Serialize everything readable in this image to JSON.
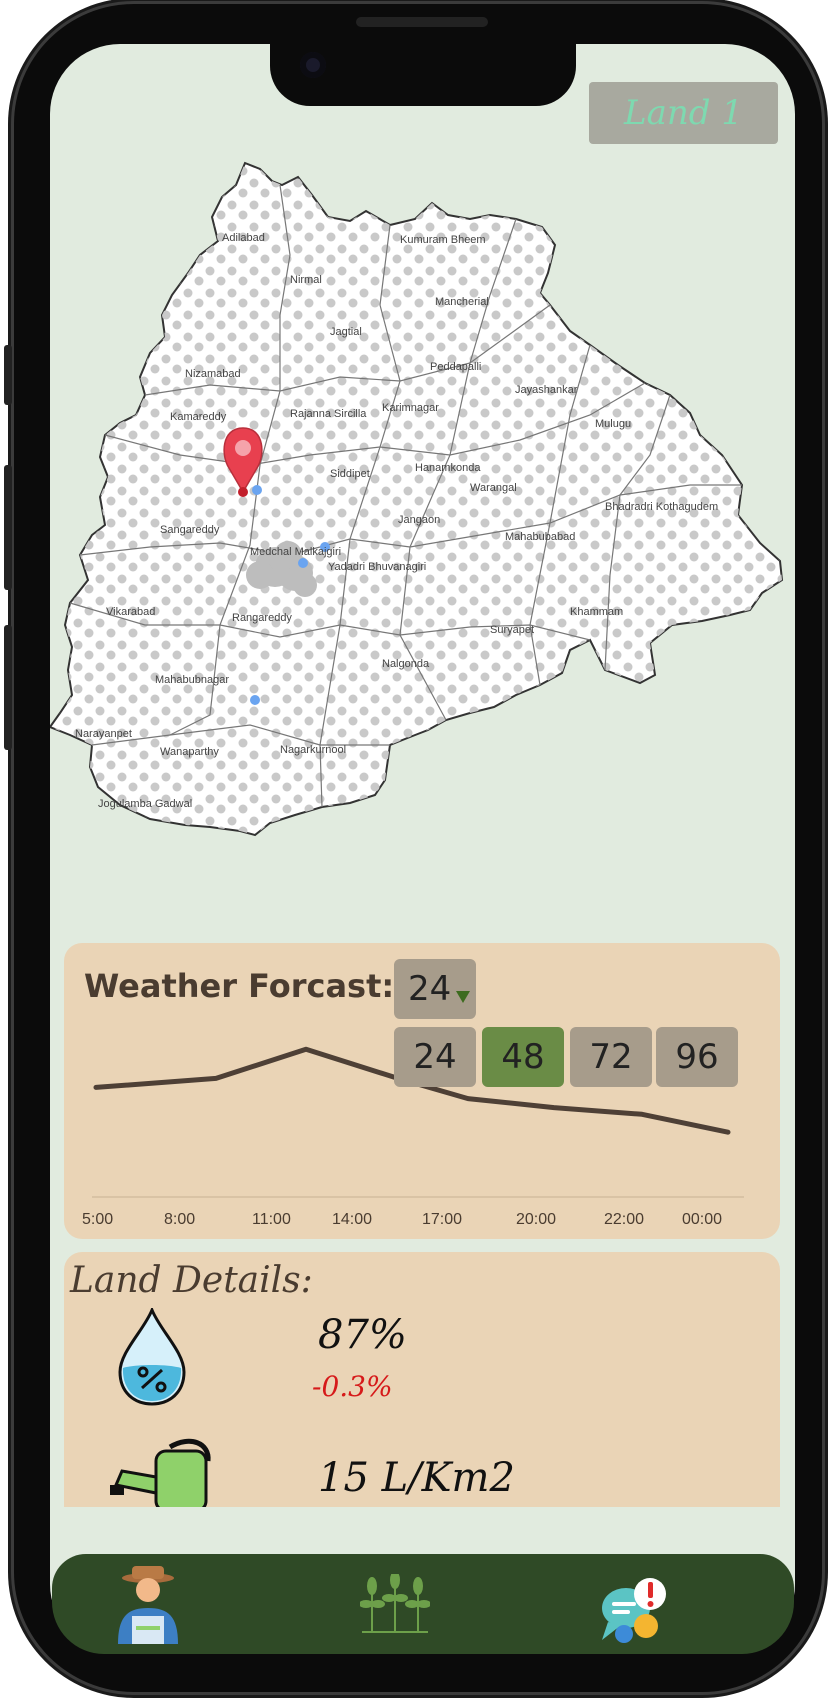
{
  "header": {
    "land_label": "Land 1"
  },
  "map": {
    "districts": [
      "Adilabad",
      "Kumuram Bheem",
      "Nirmal",
      "Mancherial",
      "Jagtial",
      "Nizamabad",
      "Peddapalli",
      "Jayashankar",
      "Kamareddy",
      "Rajanna Sircilla",
      "Karimnagar",
      "Mulugu",
      "Siddipet",
      "Hanamkonda",
      "Warangal",
      "Bhadradri Kothagudem",
      "Sangareddy",
      "Jangaon",
      "Mahabubabad",
      "Medchal Malkajgiri",
      "Yadadri Bhuvanagiri",
      "Vikarabad",
      "Rangareddy",
      "Khammam",
      "Suryapet",
      "Mahabubnagar",
      "Nalgonda",
      "Narayanpet",
      "Wanaparthy",
      "Nagarkurnool",
      "Jogulamba Gadwal"
    ],
    "pin_icon": "location-pin-icon"
  },
  "weather": {
    "title": "Weather Forcast:",
    "selected_hours": "24",
    "hour_options": [
      "24",
      "48",
      "72",
      "96"
    ],
    "active_option": "48"
  },
  "chart_data": {
    "type": "line",
    "title": "",
    "x": [
      "5:00",
      "8:00",
      "11:00",
      "14:00",
      "17:00",
      "20:00",
      "22:00",
      "00:00"
    ],
    "series": [
      {
        "values": [
          40,
          44,
          57,
          44,
          35,
          31,
          28,
          20
        ]
      }
    ],
    "ylim": [
      0,
      100
    ],
    "xlabel": "",
    "ylabel": "",
    "grid": false,
    "line_color": "#4e4036"
  },
  "land_details": {
    "title": "Land Details:",
    "moisture": {
      "icon": "water-drop-percent-icon",
      "value": "87%",
      "change": "-0.3%"
    },
    "water": {
      "icon": "watering-can-icon",
      "value": "15 L/Km2"
    }
  },
  "tabbar": {
    "tabs": [
      {
        "name": "farmer",
        "icon": "farmer-icon"
      },
      {
        "name": "crops",
        "icon": "wheat-icon"
      },
      {
        "name": "alerts",
        "icon": "chat-alert-icon"
      }
    ]
  },
  "colors": {
    "screen_bg": "#e1ebdf",
    "card_bg": "#ead4b6",
    "tab_bar": "#2f4a26",
    "land_tag_text": "#7ed9b0",
    "negative": "#d61a1a"
  }
}
